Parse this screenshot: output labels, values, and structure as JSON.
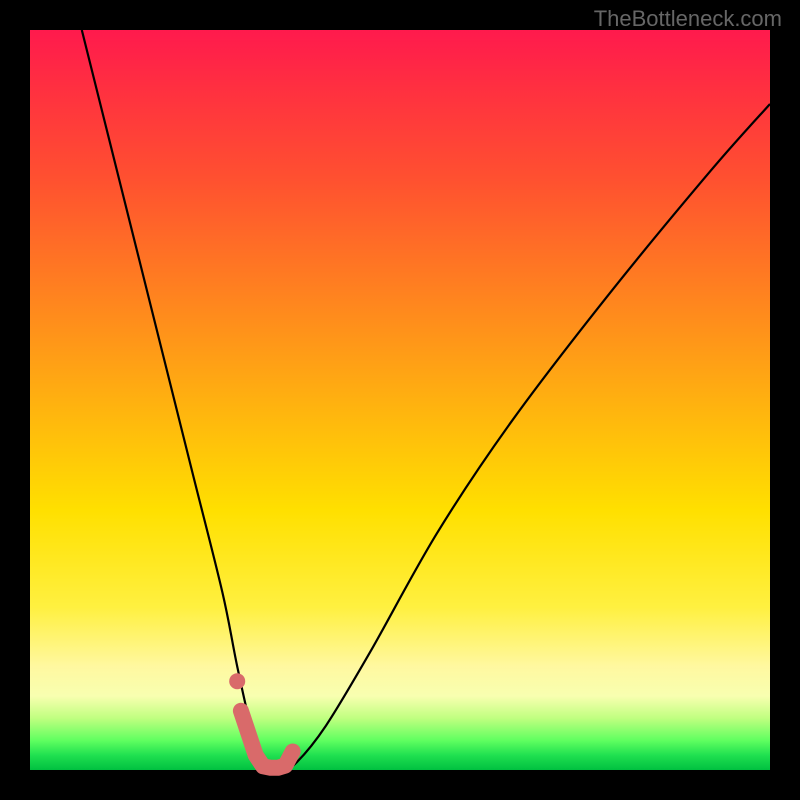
{
  "watermark": "TheBottleneck.com",
  "chart_data": {
    "type": "line",
    "title": "",
    "xlabel": "",
    "ylabel": "",
    "xlim": [
      0,
      100
    ],
    "ylim": [
      0,
      100
    ],
    "series": [
      {
        "name": "bottleneck-curve",
        "x": [
          7,
          12,
          18,
          22,
          26,
          28,
          30,
          31,
          32,
          34,
          36,
          40,
          46,
          55,
          65,
          78,
          92,
          100
        ],
        "values": [
          100,
          80,
          56,
          40,
          24,
          14,
          5,
          1,
          0,
          0,
          1,
          6,
          16,
          32,
          47,
          64,
          81,
          90
        ]
      }
    ],
    "markers": {
      "name": "highlight-band",
      "color": "#d96a6a",
      "x": [
        28.5,
        30.5,
        31.5,
        32.5,
        33.5,
        34.5,
        35.5
      ],
      "values": [
        8,
        2,
        0.5,
        0.3,
        0.3,
        0.6,
        2.5
      ]
    },
    "gradient_stops": [
      {
        "pos": 0,
        "color": "#ff1a4d"
      },
      {
        "pos": 50,
        "color": "#ffe000"
      },
      {
        "pos": 90,
        "color": "#f8ffb0"
      },
      {
        "pos": 100,
        "color": "#00c040"
      }
    ]
  }
}
